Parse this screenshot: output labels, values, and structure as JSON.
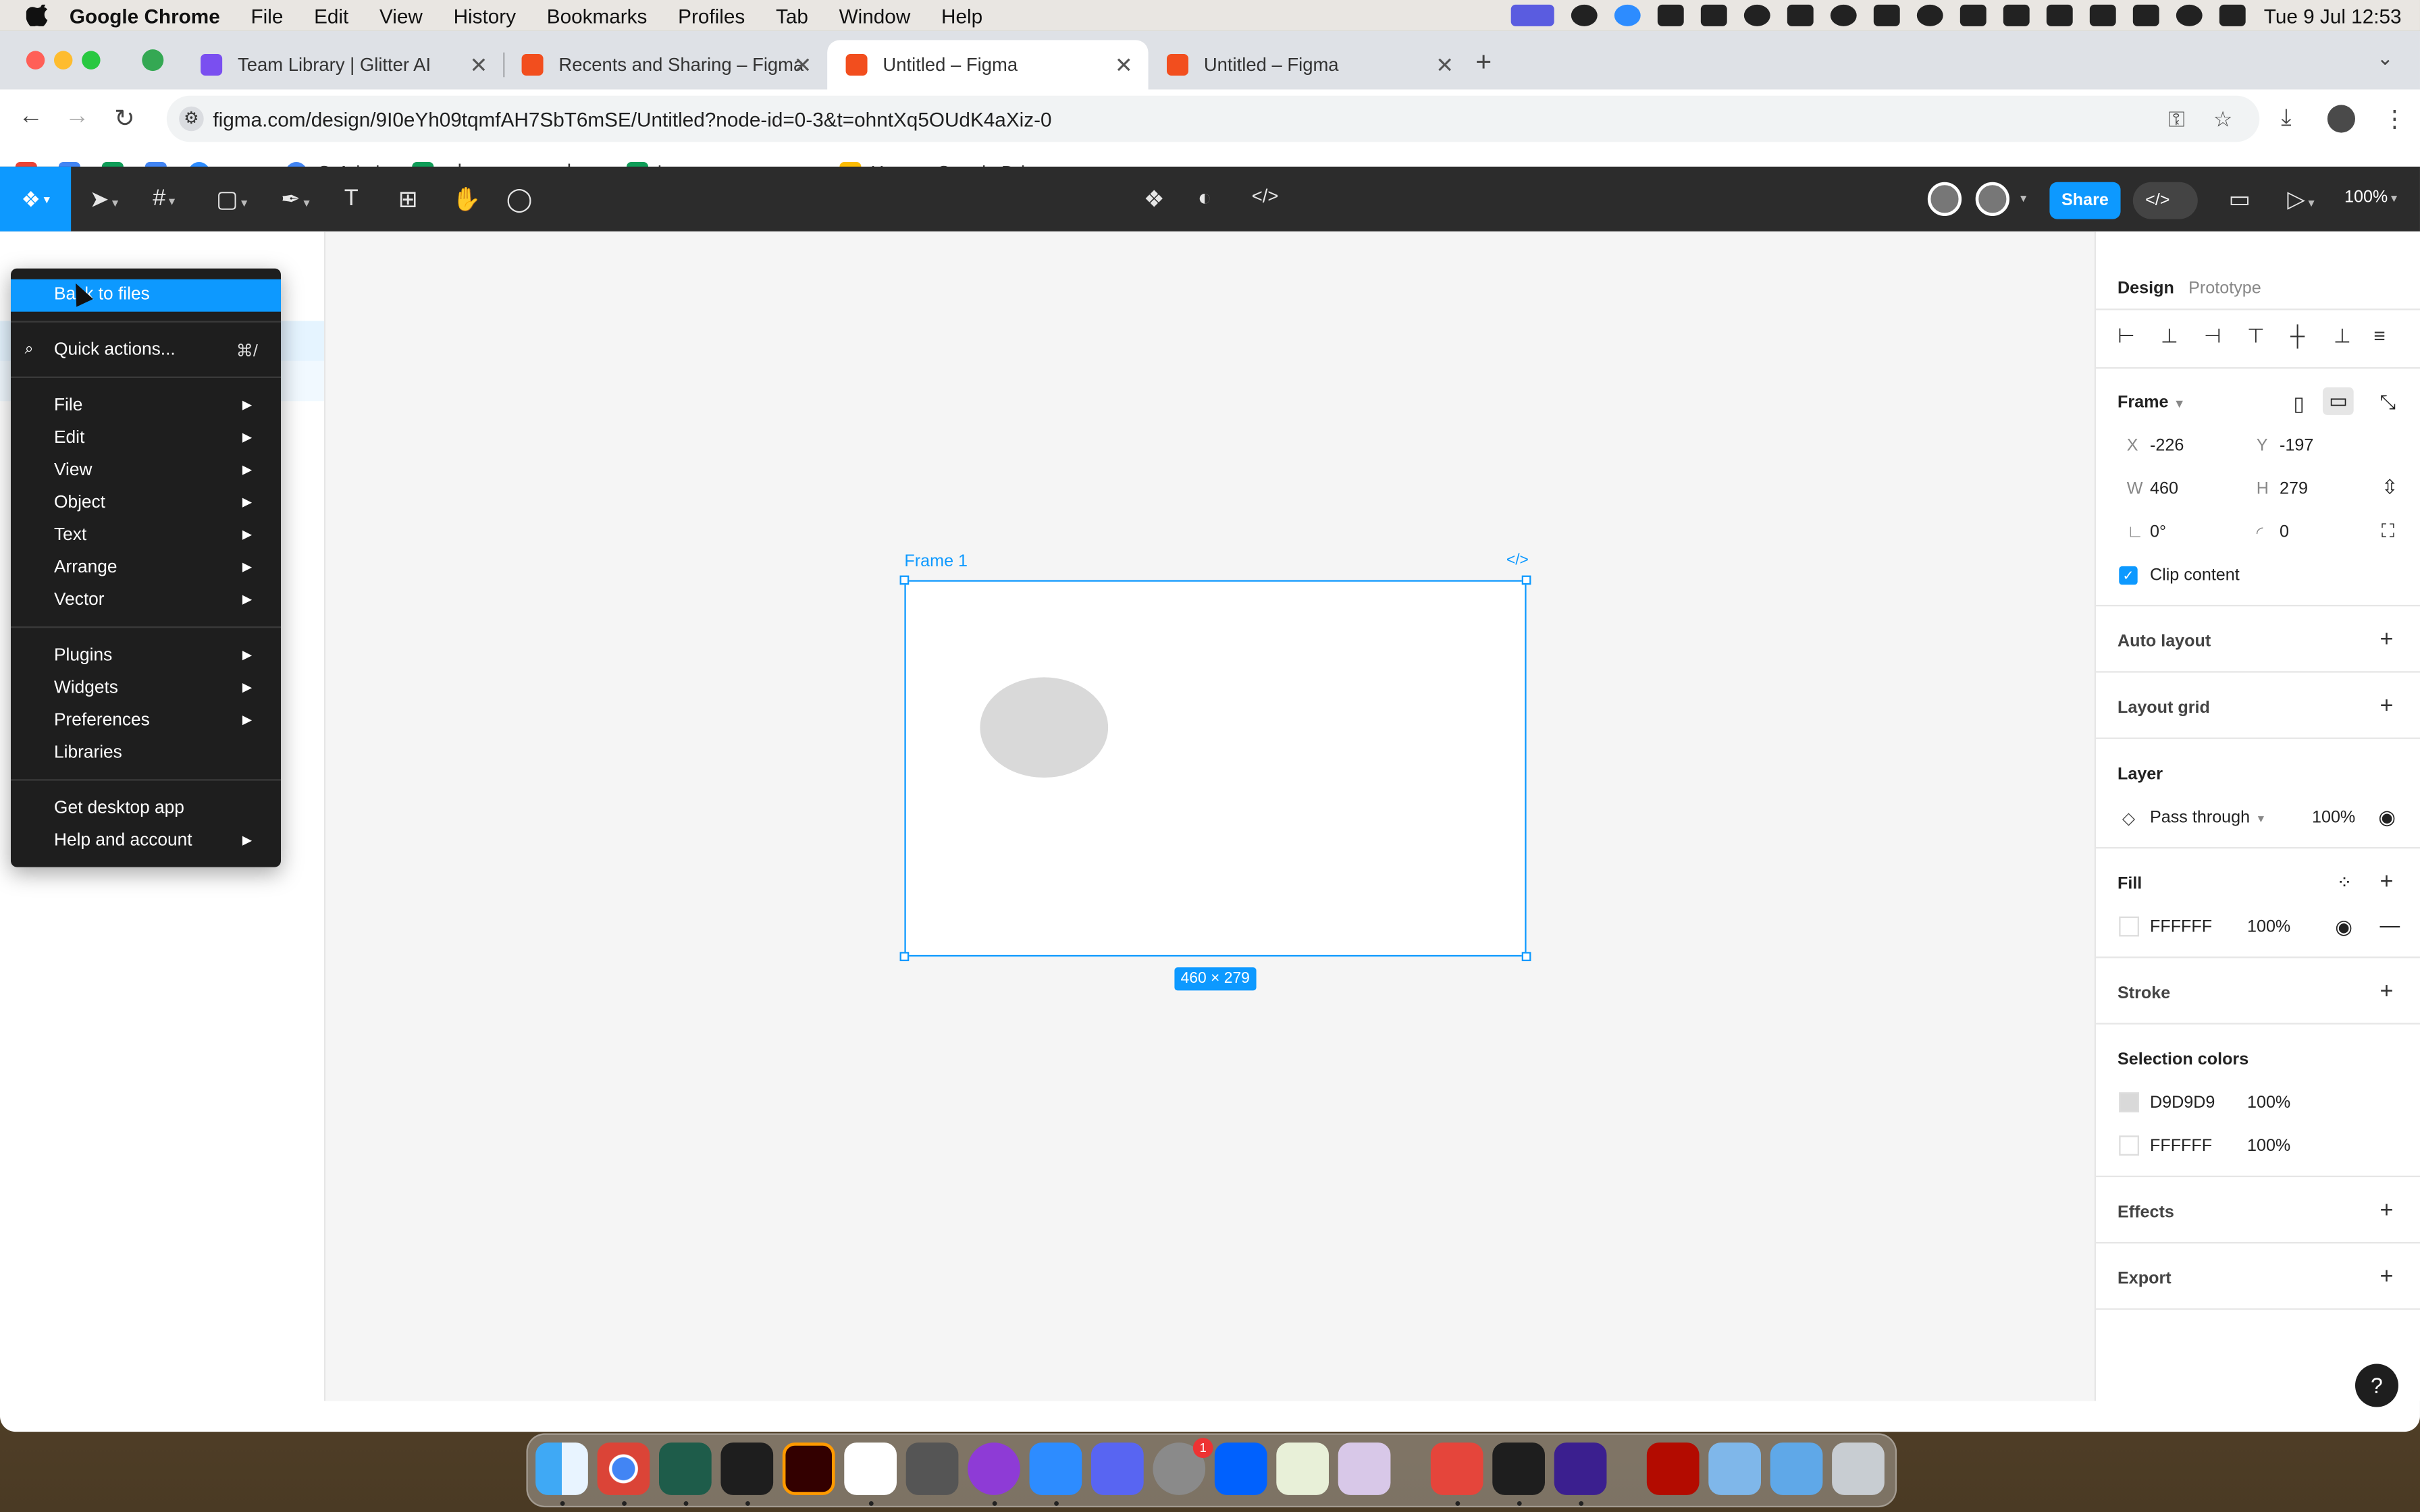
{
  "menubar": {
    "app": "Google Chrome",
    "items": [
      "File",
      "Edit",
      "View",
      "History",
      "Bookmarks",
      "Profiles",
      "Tab",
      "Window",
      "Help"
    ],
    "clock": "Tue 9 Jul  12:53"
  },
  "tabs": [
    {
      "title": "Team Library | Glitter AI",
      "color": "#7a4ff0"
    },
    {
      "title": "Recents and Sharing – Figma",
      "color": "#f24e1e"
    },
    {
      "title": "Untitled – Figma",
      "color": "#f24e1e"
    },
    {
      "title": "Untitled – Figma",
      "color": "#f24e1e"
    }
  ],
  "address": {
    "url": "figma.com/design/9I0eYh09tqmfAH7SbT6mSE/Untitled?node-id=0-3&t=ohntXq5OUdK4aXiz-0"
  },
  "bookmarks": [
    {
      "label": "zoom",
      "color": "#2d8cff"
    },
    {
      "label": "G-Admin",
      "color": "#4285f4"
    },
    {
      "label": "חלוקת משימות לפי...",
      "color": "#0f9d58"
    },
    {
      "label": "incomes outcome...",
      "color": "#0f9d58"
    },
    {
      "label": "Home - Google Dri...",
      "color": "#fbbc04"
    }
  ],
  "figma": {
    "share_label": "Share",
    "zoom": "100%",
    "frame": {
      "label": "Frame 1",
      "dims": "460 × 279"
    }
  },
  "main_menu": {
    "items": [
      {
        "label": "Back to files"
      },
      {
        "label": "Quick actions...",
        "shortcut": "⌘/"
      },
      {
        "label": "File"
      },
      {
        "label": "Edit"
      },
      {
        "label": "View"
      },
      {
        "label": "Object"
      },
      {
        "label": "Text"
      },
      {
        "label": "Arrange"
      },
      {
        "label": "Vector"
      },
      {
        "label": "Plugins"
      },
      {
        "label": "Widgets"
      },
      {
        "label": "Preferences"
      },
      {
        "label": "Libraries"
      },
      {
        "label": "Get desktop app"
      },
      {
        "label": "Help and account"
      }
    ]
  },
  "design_panel": {
    "tabs": [
      "Design",
      "Prototype"
    ],
    "frame_title": "Frame",
    "x_label": "X",
    "x": "-226",
    "y_label": "Y",
    "y": "-197",
    "w_label": "W",
    "w": "460",
    "h_label": "H",
    "h": "279",
    "rotation": "0°",
    "radius": "0",
    "clip_content": "Clip content",
    "auto_layout": "Auto layout",
    "layout_grid": "Layout grid",
    "layer": "Layer",
    "blend": "Pass through",
    "layer_opacity": "100%",
    "fill": "Fill",
    "fill_hex": "FFFFFF",
    "fill_opacity": "100%",
    "stroke": "Stroke",
    "selection_colors": "Selection colors",
    "sel": [
      {
        "hex": "D9D9D9",
        "opacity": "100%",
        "color": "#d9d9d9"
      },
      {
        "hex": "FFFFFF",
        "opacity": "100%",
        "color": "#ffffff"
      }
    ],
    "effects": "Effects",
    "export": "Export"
  }
}
